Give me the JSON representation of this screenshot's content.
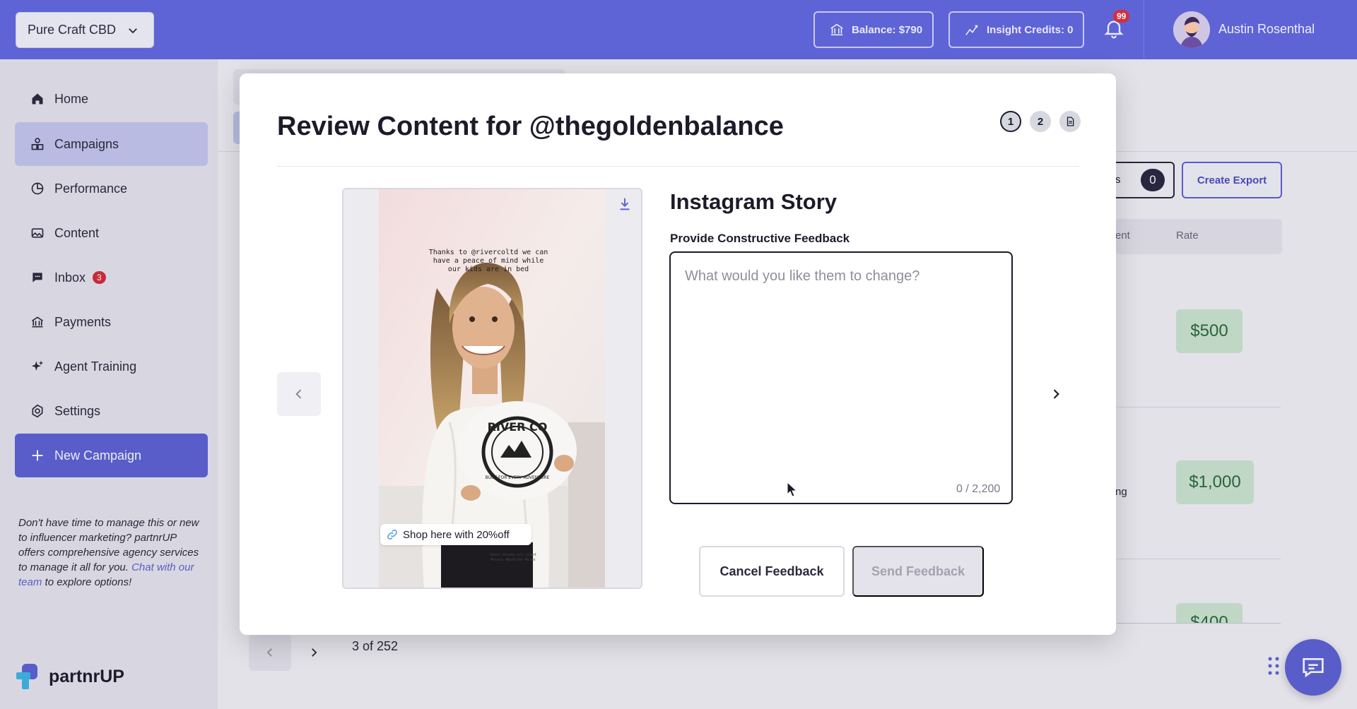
{
  "header": {
    "org_name": "Pure Craft CBD",
    "balance_label": "Balance: $790",
    "insight_label": "Insight Credits: 0",
    "notification_count": "99",
    "user_name": "Austin Rosenthal"
  },
  "sidebar": {
    "items": [
      {
        "label": "Home",
        "icon": "home-icon"
      },
      {
        "label": "Campaigns",
        "icon": "campaigns-icon"
      },
      {
        "label": "Performance",
        "icon": "performance-icon"
      },
      {
        "label": "Content",
        "icon": "image-icon"
      },
      {
        "label": "Inbox",
        "icon": "chat-icon",
        "badge": "3"
      },
      {
        "label": "Payments",
        "icon": "bank-icon"
      },
      {
        "label": "Agent Training",
        "icon": "sparkle-icon"
      },
      {
        "label": "Settings",
        "icon": "gear-icon"
      }
    ],
    "new_campaign_label": "New Campaign",
    "promo_text": "Don't have time to manage this or new to influencer marketing? partnrUP offers comprehensive agency services to manage it all for you.",
    "promo_link": "Chat with our team",
    "promo_suffix": "to explore options!",
    "logo_text": "partnrUP"
  },
  "background": {
    "export_label": "Create Export",
    "count_value": "0",
    "col_partial": "ent",
    "col_rate": "Rate",
    "rates": [
      "$500",
      "$1,000",
      "$400"
    ],
    "row_partial": "ng",
    "pager_text": "3 of 252"
  },
  "modal": {
    "title": "Review Content for @thegoldenbalance",
    "steps": [
      "1",
      "2"
    ],
    "content_type": "Instagram Story",
    "feedback_label": "Provide Constructive Feedback",
    "feedback_placeholder": "What would you like them to change?",
    "char_count": "0 / 2,200",
    "cancel_label": "Cancel Feedback",
    "send_label": "Send Feedback",
    "story": {
      "caption": "Thanks to @rivercoltd we can have a peace of mind while our kids are in bed",
      "sticker": "Shop here with 20%off",
      "fine_print": "Sweet dreams all night #stars #bedtime #kids",
      "pillow_text": "RIVER CO",
      "pillow_sub": "BUILT FOR EVERY ADVENTURE"
    }
  },
  "colors": {
    "brand": "#5e63d6",
    "active_nav": "#c8c9f1",
    "rate_bg": "#cfe8d3",
    "badge_red": "#d62d3c"
  }
}
